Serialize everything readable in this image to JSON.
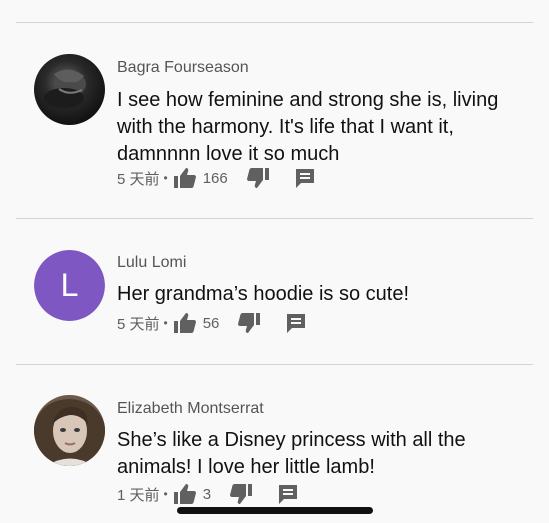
{
  "comments": [
    {
      "author": "Bagra Fourseason",
      "text": "I see how feminine and strong she is, living with the harmony. It's life that I want it,  damnnnn love it so much",
      "time": "5 天前",
      "likes": "166"
    },
    {
      "author": "Lulu Lomi",
      "avatar_letter": "L",
      "avatar_color": "#7e57c2",
      "text": "Her grandma’s hoodie is so cute!",
      "time": "5 天前",
      "likes": "56"
    },
    {
      "author": "Elizabeth Montserrat",
      "text": "She’s like a Disney princess with all the animals! I love her little lamb!",
      "time": "1 天前",
      "likes": "3"
    }
  ],
  "meta_separator": "•",
  "icons": {
    "like": "thumb-up-icon",
    "dislike": "thumb-down-icon",
    "reply": "reply-comment-icon"
  }
}
